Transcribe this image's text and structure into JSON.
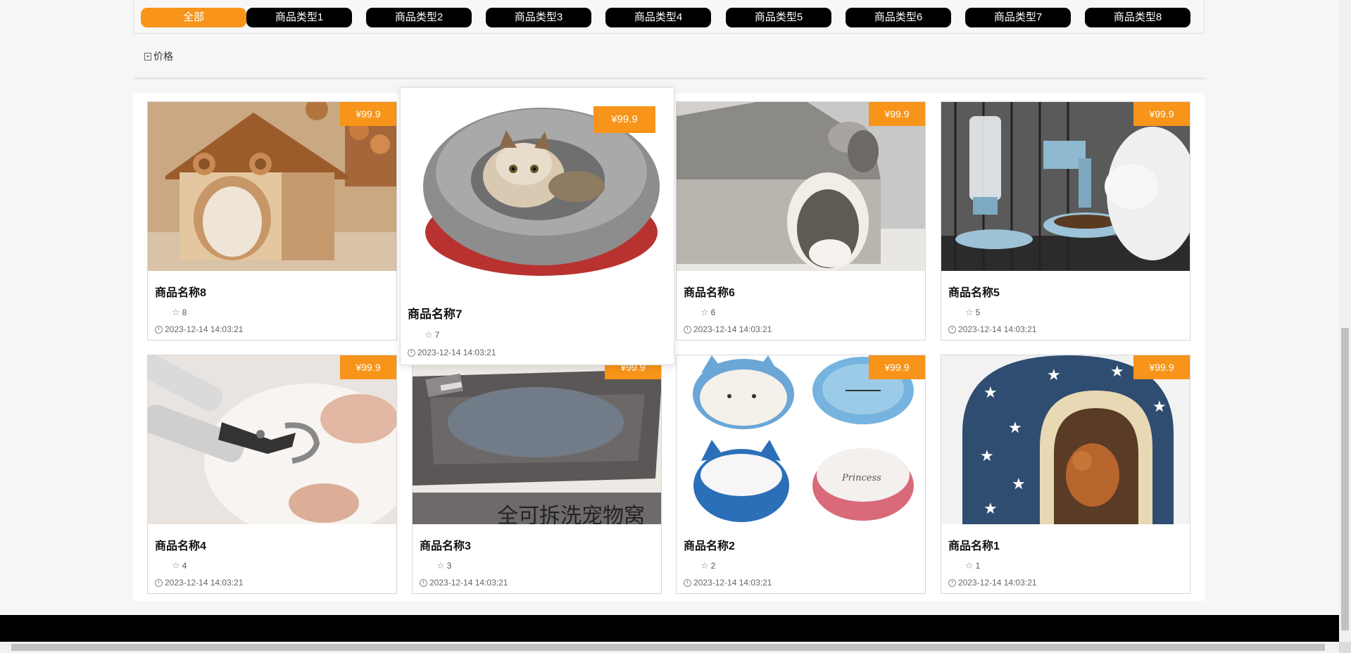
{
  "tabs": [
    "全部",
    "商品类型1",
    "商品类型2",
    "商品类型3",
    "商品类型4",
    "商品类型5",
    "商品类型6",
    "商品类型7",
    "商品类型8"
  ],
  "sort": {
    "label": "价格",
    "icon": "sort-icon"
  },
  "products": [
    {
      "name": "商品名称8",
      "price": "¥99.9",
      "likes": "8",
      "date": "2023-12-14 14:03:21",
      "image": "pet-house-bear"
    },
    {
      "name": "商品名称7",
      "price": "¥99.9",
      "likes": "7",
      "date": "2023-12-14 14:03:21",
      "image": "cat-plush-bed"
    },
    {
      "name": "商品名称6",
      "price": "¥99.9",
      "likes": "6",
      "date": "2023-12-14 14:03:21",
      "image": "pet-house-dog"
    },
    {
      "name": "商品名称5",
      "price": "¥99.9",
      "likes": "5",
      "date": "2023-12-14 14:03:21",
      "image": "auto-feeder-cat"
    },
    {
      "name": "商品名称4",
      "price": "¥99.9",
      "likes": "4",
      "date": "2023-12-14 14:03:21",
      "image": "nail-clipper"
    },
    {
      "name": "商品名称3",
      "price": "¥99.9",
      "likes": "3",
      "date": "2023-12-14 14:03:21",
      "image": "sofa-bed"
    },
    {
      "name": "商品名称2",
      "price": "¥99.9",
      "likes": "2",
      "date": "2023-12-14 14:03:21",
      "image": "cat-bowls"
    },
    {
      "name": "商品名称1",
      "price": "¥99.9",
      "likes": "1",
      "date": "2023-12-14 14:03:21",
      "image": "star-pet-house"
    }
  ],
  "product_image_text": {
    "sofa_bed_caption": "全可拆洗宠物窝",
    "bowl_label": "Princess"
  },
  "colors": {
    "accent": "#f79419",
    "tab_bg": "#000000",
    "footer": "#000000"
  }
}
